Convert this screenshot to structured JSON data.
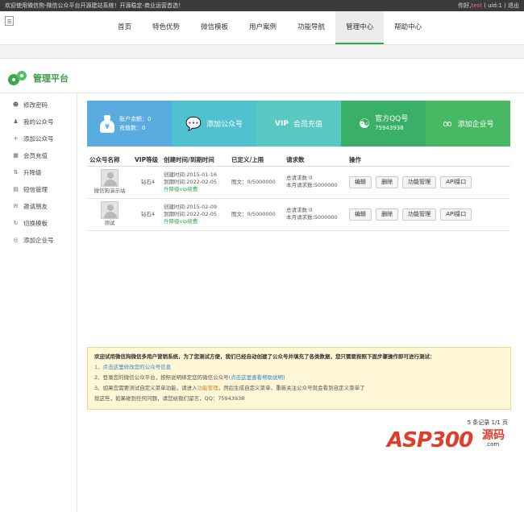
{
  "topbar": {
    "welcome": "欢迎使用微信狗-微信公众平台开源建站系统！开源稳定-商业运营首选！",
    "greeting_prefix": "你好,",
    "username": "test",
    "uid": "( uid:1 )",
    "logout": "退出"
  },
  "nav": {
    "items": [
      "首页",
      "特色优势",
      "微信模板",
      "用户案例",
      "功能导航",
      "管理中心",
      "帮助中心"
    ],
    "active": "管理中心"
  },
  "platform_title": "管理平台",
  "sidebar": {
    "items": [
      {
        "label": "修改密码",
        "icon": "user-icon"
      },
      {
        "label": "我的公众号",
        "icon": "person-icon"
      },
      {
        "label": "添加公众号",
        "icon": "plus-icon"
      },
      {
        "label": "会员充值",
        "icon": "card-icon"
      },
      {
        "label": "升降级",
        "icon": "arrows-icon"
      },
      {
        "label": "短信管理",
        "icon": "doc-icon"
      },
      {
        "label": "邀请朋友",
        "icon": "invite-icon"
      },
      {
        "label": "切换模板",
        "icon": "refresh-icon"
      },
      {
        "label": "添加企业号",
        "icon": "target-icon"
      }
    ]
  },
  "tiles": {
    "balance_label": "账户余额：0",
    "recharge_label": "充值数：0",
    "add_account": "添加公众号",
    "vip_recharge": "会员充值",
    "qq_label": "官方QQ号",
    "qq_number": "75943938",
    "add_enterprise": "添加企业号"
  },
  "table": {
    "headers": [
      "公众号名称",
      "VIP等级",
      "创建时间/到期时间",
      "已定义/上限",
      "请求数",
      "操作"
    ],
    "rows": [
      {
        "name": "微信狗演示站",
        "vip": "钻石4",
        "created": "创建时间:2015-01-16",
        "expires": "到期时间:2022-02-05",
        "upgrade": "升降级vip续费",
        "quota": "图文：0/5000000",
        "total_requests": "总请求数:0",
        "month_requests": "本月请求数:5000000"
      },
      {
        "name": "测试",
        "vip": "钻石4",
        "created": "创建时间:2015-02-09",
        "expires": "到期时间:2022-02-05",
        "upgrade": "升降级vip续费",
        "quota": "图文：0/5000000",
        "total_requests": "总请求数:0",
        "month_requests": "本月请求数:5000000"
      }
    ],
    "actions": {
      "edit": "编辑",
      "delete": "删除",
      "features": "功能管理",
      "api": "API接口"
    }
  },
  "notice": {
    "intro": "欢迎试用微信狗微信多用户营销系统，为了您测试方便，我们已经自动创建了公众号并填充了各类数据，您只需要按照下面步骤操作即可进行测试：",
    "step1": "1、点击这里修改您的公众号信息",
    "step2_a": "2、登录您的微信公众平台，按照说明绑定您的微信公众号",
    "step2_b": "(点击这里查看帮助说明)",
    "step3_a": "3、如果您需要测试自定义菜单功能，请进入",
    "step3_link": "功能管理",
    "step3_b": "，然后生成自定义菜单，重新关注公众号就会看到自定义菜单了",
    "contact": "就这些，如果碰到任何问题，请您给我们留言，QQ：75943938"
  },
  "pager": "5 条记录 1/1 页",
  "watermark": {
    "brand": "ASP300",
    "suffix": "源码",
    "domain": ".com"
  }
}
